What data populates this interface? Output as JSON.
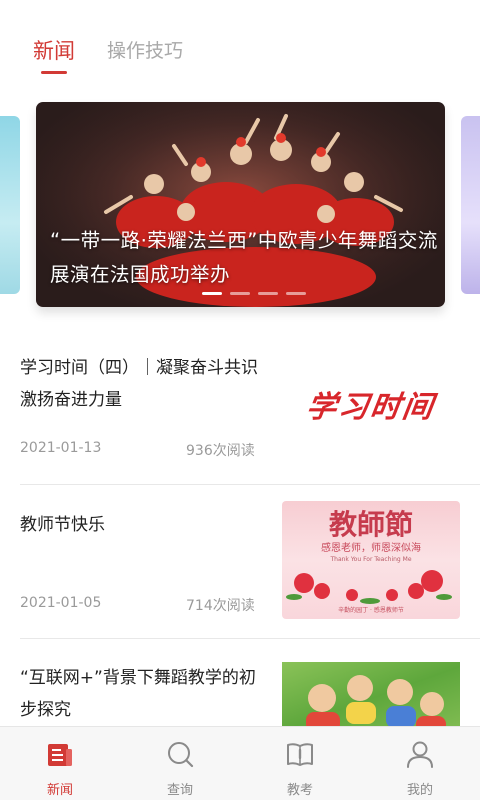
{
  "tabs": [
    {
      "label": "新闻",
      "active": true
    },
    {
      "label": "操作技巧",
      "active": false
    }
  ],
  "banner": {
    "caption": "“一带一路·荣耀法兰西”中欧青少年舞蹈交流展演在法国成功举办",
    "slide_count": 4,
    "active_slide": 1
  },
  "news": [
    {
      "title": "学习时间（四）｜凝聚奋斗共识 激扬奋进力量",
      "date": "2021-01-13",
      "reads": "936次阅读",
      "thumb_text": "学习时间"
    },
    {
      "title": "教师节快乐",
      "date": "2021-01-05",
      "reads": "714次阅读",
      "thumb_title": "教師節",
      "thumb_sub": "感恩老师，师恩深似海",
      "thumb_en": "Thank You For Teaching Me",
      "thumb_foot": "辛勤的园丁 · 感恩教师节"
    },
    {
      "title": "“互联网+”背景下舞蹈教学的初步探究",
      "date": "",
      "reads": ""
    }
  ],
  "bottom_nav": [
    {
      "label": "新闻",
      "icon": "news-icon",
      "active": true
    },
    {
      "label": "查询",
      "icon": "search-icon",
      "active": false
    },
    {
      "label": "教考",
      "icon": "book-icon",
      "active": false
    },
    {
      "label": "我的",
      "icon": "profile-icon",
      "active": false
    }
  ],
  "colors": {
    "accent": "#d23a35",
    "muted": "#9a9a9a",
    "nav_bg": "#f7f7f7"
  }
}
